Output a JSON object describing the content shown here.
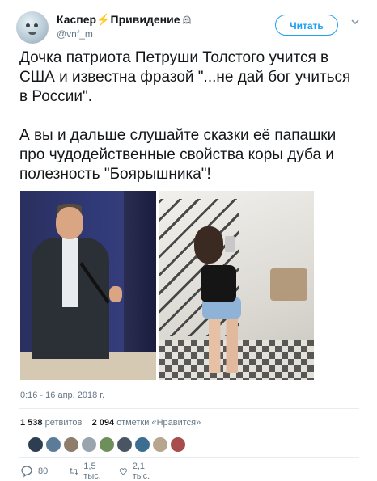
{
  "user": {
    "display_name": "Каспер",
    "display_name_suffix": "Привидение",
    "handle": "@vnf_m"
  },
  "follow_button": {
    "label": "Читать"
  },
  "tweet": {
    "paragraph1": "Дочка пaтриота Петруши Толстого учится в США и известна фразой \"...не дай бог учиться в России\".",
    "paragraph2": "А вы и дальше слушайте сказки её папашки про чудодейственные свойства коры дуба и полезность \"Боярышника\"!"
  },
  "timestamp": "0:16 - 16 апр. 2018 г.",
  "stats": {
    "retweets_count": "1 538",
    "retweets_label": "ретвитов",
    "likes_count": "2 094",
    "likes_label": "отметки «Нравится»"
  },
  "liker_avatars": [
    "#2c3e50",
    "#5b7c99",
    "#8e7d6b",
    "#9aa4ad",
    "#6f8f5a",
    "#4a5563",
    "#3c6e91",
    "#b8a58e",
    "#a84d4d"
  ],
  "actions": {
    "reply_count": "80",
    "retweet_count": "1,5 тыс.",
    "like_count": "2,1 тыс."
  },
  "colors": {
    "accent": "#1da1f2",
    "secondary_text": "#657786"
  }
}
